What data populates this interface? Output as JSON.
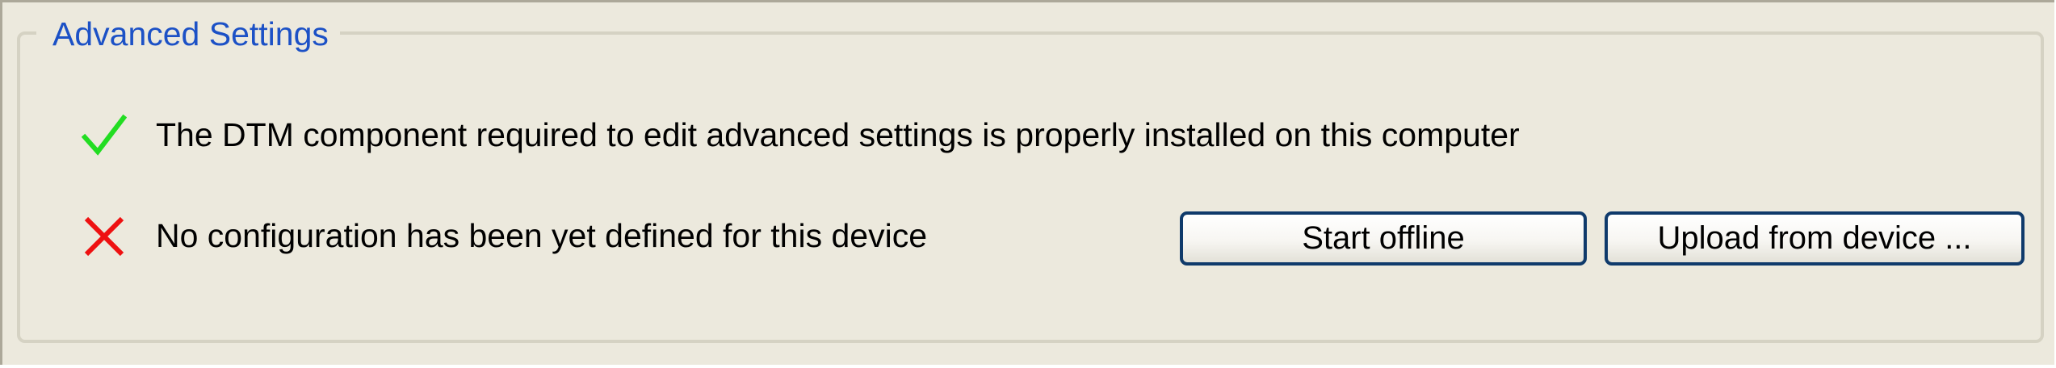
{
  "group": {
    "title": "Advanced Settings"
  },
  "status": [
    {
      "icon": "checkmark-icon",
      "color": "#22dd22",
      "text": "The DTM component required to edit advanced settings is properly installed on this computer"
    },
    {
      "icon": "cross-icon",
      "color": "#ee1111",
      "text": "No configuration has been yet defined for this device"
    }
  ],
  "buttons": {
    "start_offline_label": "Start offline",
    "upload_label": "Upload from device ..."
  }
}
